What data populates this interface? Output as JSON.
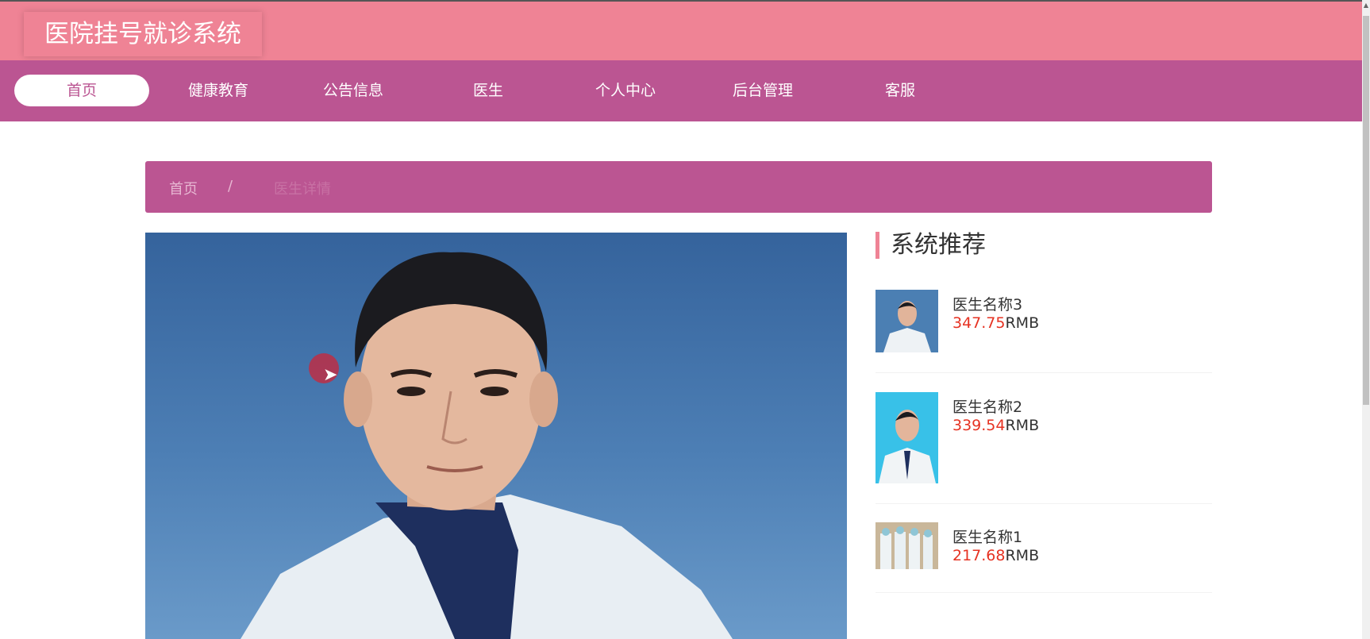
{
  "app_title": "医院挂号就诊系统",
  "nav": [
    {
      "label": "首页",
      "active": true
    },
    {
      "label": "健康教育",
      "active": false
    },
    {
      "label": "公告信息",
      "active": false
    },
    {
      "label": "医生",
      "active": false
    },
    {
      "label": "个人中心",
      "active": false
    },
    {
      "label": "后台管理",
      "active": false
    },
    {
      "label": "客服",
      "active": false
    }
  ],
  "breadcrumb": {
    "home": "首页",
    "separator": "/",
    "current": "医生详情"
  },
  "sidebar": {
    "title": "系统推荐",
    "items": [
      {
        "name": "医生名称3",
        "price": "347.75",
        "unit": "RMB"
      },
      {
        "name": "医生名称2",
        "price": "339.54",
        "unit": "RMB"
      },
      {
        "name": "医生名称1",
        "price": "217.68",
        "unit": "RMB"
      }
    ]
  },
  "colors": {
    "header_pink": "#ef8395",
    "nav_magenta": "#bb5592",
    "price_red": "#e63222"
  }
}
